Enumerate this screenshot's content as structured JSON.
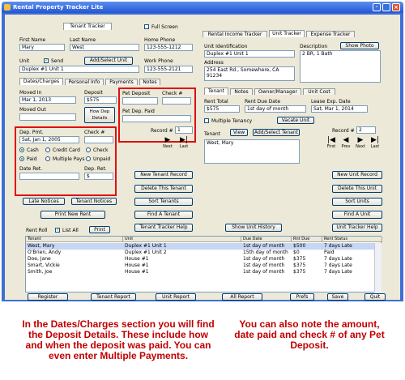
{
  "window": {
    "title": "Rental Property Tracker Lite"
  },
  "tenant_tab": "Tenant Tracker",
  "full_screen": "Full Screen",
  "labels": {
    "first_name": "First Name",
    "last_name": "Last Name",
    "home_phone": "Home Phone",
    "unit": "Unit",
    "send": "Send",
    "work_phone": "Work Phone"
  },
  "tenant": {
    "first_name": "Mary",
    "last_name": "West",
    "home_phone": "123-555-1212",
    "unit": "Duplex #1 Unit 1",
    "work_phone": "123-555-2121"
  },
  "add_select_unit": "Add/Select Unit",
  "sub_tabs": [
    "Dates/Charges",
    "Personal Info",
    "Payments",
    "Notes"
  ],
  "dates": {
    "moved_in_label": "Moved In",
    "moved_in": "Mar 1, 2013",
    "deposit_label": "Deposit",
    "deposit": "$575",
    "moved_out_label": "Moved Out",
    "how_dep_details": "How Dep Details"
  },
  "pet": {
    "pet_deposit_label": "Pet Deposit",
    "check_label": "Check #",
    "pet_dep_paid": "Pet Dep. Paid"
  },
  "dep_pmt": {
    "dep_pmt_label": "Dep. Pmt.",
    "check_label": "Check #",
    "date": "Sat, Jan 1, 2005",
    "cash": "Cash",
    "credit_card": "Credit Card",
    "check": "Check",
    "paid": "Paid",
    "multiple_pays": "Multiple Pays",
    "unpaid": "Unpaid",
    "date_ret_label": "Date Ret.",
    "dep_ret_label": "Dep. Ret.",
    "dep_ret": "$"
  },
  "record": {
    "label": "Record #",
    "tenant_no": "1",
    "unit_no": "2"
  },
  "nav": {
    "next": "Next",
    "last": "Last",
    "first": "First",
    "prev": "Prev"
  },
  "tenant_buttons": {
    "late_notices": "Late Notices",
    "tenant_notices": "Tenant Notices",
    "print_new_rent": "Print New Rent",
    "new_tenant_record": "New Tenant Record",
    "delete_this_tenant": "Delete This Tenant",
    "sort_tenants": "Sort Tenants",
    "find_a_tenant": "Find A Tenant",
    "tenant_tracker_help": "Tenant Tracker Help"
  },
  "rent_roll": {
    "label": "Rent Roll",
    "list_all": "List All",
    "print": "Print"
  },
  "right_tabs": [
    "Rental Income Tracker",
    "Unit Tracker",
    "Expense Tracker"
  ],
  "unit_info": {
    "unit_id_label": "Unit Identification",
    "unit_id": "Duplex #1 Unit 1",
    "description_label": "Description",
    "description": "2 BR, 1 Bath",
    "address_label": "Address",
    "address": "254 East Rd., Somewhere, CA 91234",
    "show_photo": "Show Photo"
  },
  "unit_sub_tabs": [
    "Tenant",
    "Notes",
    "Owner/Manager",
    "Unit Cost"
  ],
  "rent": {
    "total_label": "Rent Total",
    "due_label": "Rent Due Date",
    "lease_exp_label": "Lease Exp. Date",
    "total": "$575",
    "due": "1st day of month",
    "lease_exp": "Sat, Mar 1, 2014"
  },
  "multiple_tenancy": "Multiple Tenancy",
  "vacate_unit": "Vacate Unit",
  "tenant_row": {
    "label": "Tenant",
    "view": "View",
    "add_select_tenant": "Add/Select Tenant",
    "name": "West, Mary"
  },
  "unit_buttons": {
    "new_unit_record": "New Unit Record",
    "delete_this_unit": "Delete This Unit",
    "sort_units": "Sort Units",
    "find_a_unit": "Find A Unit",
    "unit_tracker_help": "Unit Tracker Help",
    "show_unit_history": "Show Unit History"
  },
  "grid": {
    "headers": [
      "Tenant",
      "Unit",
      "Due Date",
      "Rnt Due",
      "Rent Status"
    ],
    "rows": [
      [
        "West, Mary",
        "Duplex #1 Unit 1",
        "1st day of month",
        "$500",
        "7 days Late"
      ],
      [
        "O'Brien, Andy",
        "Duplex #1 Unit 2",
        "15th day of month",
        "$0",
        "Paid"
      ],
      [
        "Doe, Jane",
        "House #1",
        "1st day of month",
        "$375",
        "7 days Late"
      ],
      [
        "Smart, Vickie",
        "House #1",
        "1st day of month",
        "$375",
        "7 days Late"
      ],
      [
        "Smith, Joe",
        "House #1",
        "1st day of month",
        "$375",
        "7 days Late"
      ]
    ]
  },
  "bottom_buttons": [
    "Register",
    "Tenant Report",
    "Unit Report",
    "All Report",
    "Prefs",
    "Save",
    "Quit"
  ],
  "captions": {
    "left": "In the Dates/Charges section you will find the Deposit Details. These include how and when the deposit was paid. You can even enter Multiple Payments.",
    "right": "You can also note the amount, date paid and check # of any Pet Deposit."
  },
  "colors": {
    "highlight": "#e01010",
    "caption": "#c00000",
    "title_bar": "#2557d4"
  }
}
